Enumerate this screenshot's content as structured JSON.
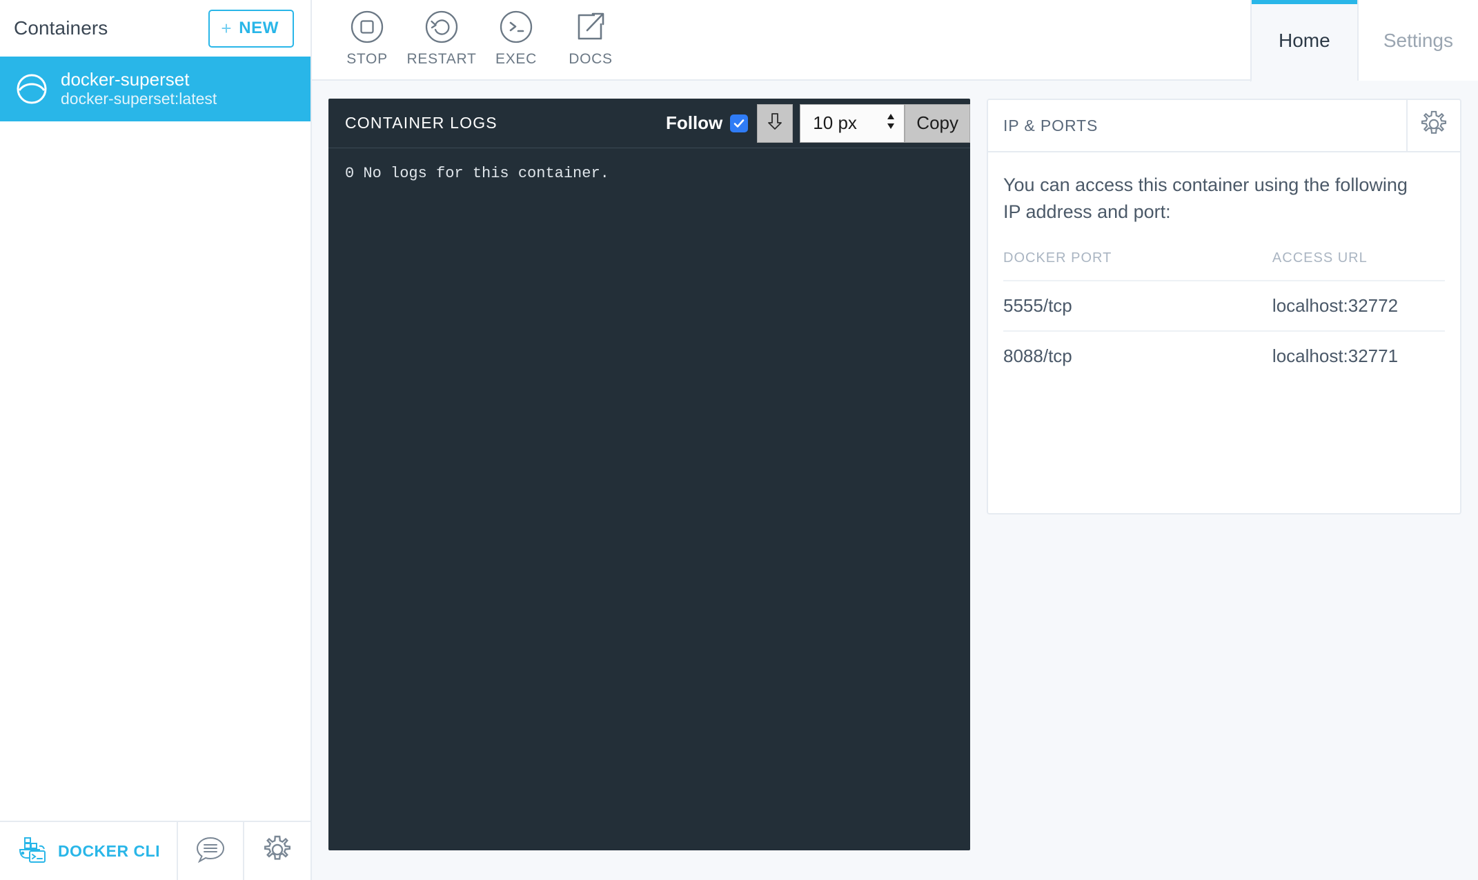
{
  "sidebar": {
    "title": "Containers",
    "new_button": {
      "plus": "+",
      "label": "NEW"
    },
    "containers": [
      {
        "name": "docker-superset",
        "image": "docker-superset:latest",
        "selected": true,
        "icon": "container-circle-icon"
      }
    ],
    "footer": {
      "docker_cli_label": "DOCKER CLI",
      "docker_cli_icon": "docker-whale-terminal-icon",
      "chat_icon": "chat-bubble-icon",
      "settings_icon": "gear-icon"
    }
  },
  "topbar": {
    "actions": [
      {
        "label": "STOP",
        "icon": "stop-square-circle-icon"
      },
      {
        "label": "RESTART",
        "icon": "restart-arrow-circle-icon"
      },
      {
        "label": "EXEC",
        "icon": "terminal-prompt-circle-icon"
      },
      {
        "label": "DOCS",
        "icon": "external-link-icon"
      }
    ],
    "tabs": [
      {
        "label": "Home",
        "active": true
      },
      {
        "label": "Settings",
        "active": false
      }
    ]
  },
  "logs": {
    "title": "CONTAINER LOGS",
    "follow_label": "Follow",
    "follow_checked": true,
    "download_icon": "download-arrow-icon",
    "font_size_value": "10 px",
    "copy_label": "Copy",
    "body": "0 No logs for this container."
  },
  "ports": {
    "title": "IP & PORTS",
    "gear_icon": "gear-icon",
    "description": "You can access this container using the following IP address and port:",
    "columns": [
      "DOCKER PORT",
      "ACCESS URL"
    ],
    "rows": [
      {
        "port": "5555/tcp",
        "url": "localhost:32772"
      },
      {
        "port": "8088/tcp",
        "url": "localhost:32771"
      }
    ]
  },
  "colors": {
    "accent": "#29b6e8",
    "log_panel_bg": "#232f38",
    "page_bg": "#f6f8fb",
    "checkbox_blue": "#2f7cf6"
  }
}
